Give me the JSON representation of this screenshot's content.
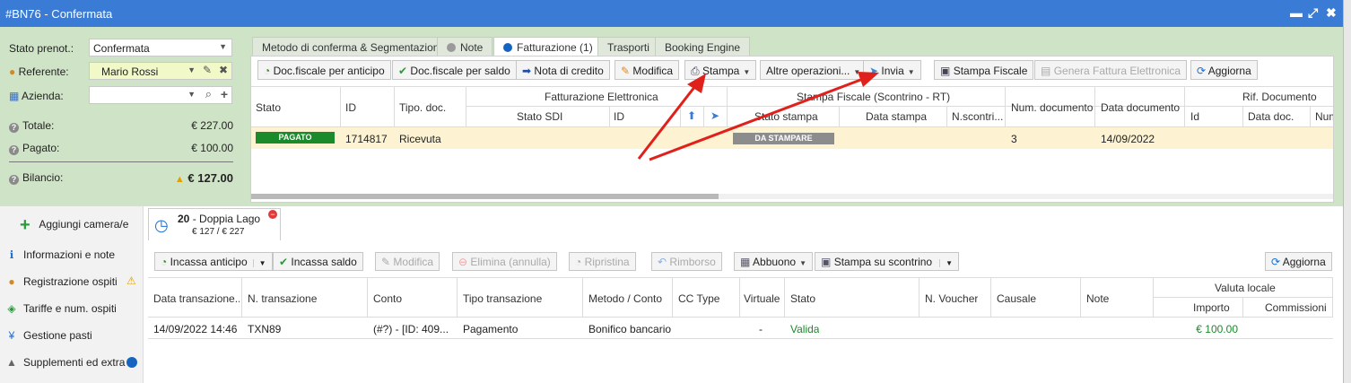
{
  "window": {
    "title": "#BN76 - Confermata",
    "controls": [
      "▬",
      "⤢",
      "✖"
    ]
  },
  "summary": {
    "stato_label": "Stato prenot.:",
    "stato_value": "Confermata",
    "referente_label": "Referente:",
    "referente_value": "Mario Rossi",
    "azienda_label": "Azienda:",
    "azienda_value": "",
    "totale_label": "Totale:",
    "totale_value": "€ 227.00",
    "pagato_label": "Pagato:",
    "pagato_value": "€ 100.00",
    "bilancio_label": "Bilancio:",
    "bilancio_value": "€ 127.00"
  },
  "tabs": [
    {
      "label": "Metodo di conferma & Segmentazione"
    },
    {
      "label": "Note"
    },
    {
      "label": "Fatturazione (1)"
    },
    {
      "label": "Trasporti"
    },
    {
      "label": "Booking Engine"
    }
  ],
  "toolbar": {
    "anticipo": "Doc.fiscale per anticipo",
    "saldo": "Doc.fiscale per saldo",
    "nota": "Nota di credito",
    "modifica": "Modifica",
    "stampa": "Stampa",
    "altre": "Altre operazioni...",
    "invia": "Invia",
    "stampa_fiscale": "Stampa Fiscale",
    "genera": "Genera Fattura Elettronica",
    "aggiorna": "Aggiorna"
  },
  "invoice_table": {
    "headers": {
      "stato": "Stato",
      "id": "ID",
      "tipo": "Tipo. doc.",
      "fe_group": "Fatturazione Elettronica",
      "stato_sdi": "Stato SDI",
      "fe_id": "ID",
      "sf_group": "Stampa Fiscale (Scontrino - RT)",
      "stato_stampa": "Stato stampa",
      "data_stampa": "Data stampa",
      "n_scontrino": "N.scontri...",
      "num_doc": "Num. documento",
      "data_doc": "Data documento",
      "rif_group": "Rif. Documento",
      "rif_id": "Id",
      "rif_data": "Data doc.",
      "rif_num": "Num"
    },
    "row": {
      "stato": "PAGATO",
      "id": "1714817",
      "tipo": "Ricevuta",
      "stato_stampa": "DA STAMPARE",
      "num_doc": "3",
      "data_doc": "14/09/2022"
    }
  },
  "rooms": {
    "add_label": "Aggiungi camera/e",
    "room_number": "20",
    "room_name": "- Doppia Lago",
    "room_amount": "€ 127 / € 227"
  },
  "nav": [
    {
      "label": "Informazioni e note"
    },
    {
      "label": "Registrazione ospiti"
    },
    {
      "label": "Tariffe e num. ospiti"
    },
    {
      "label": "Gestione pasti"
    },
    {
      "label": "Supplementi ed extra"
    }
  ],
  "pay_toolbar": {
    "incassa_anticipo": "Incassa anticipo",
    "incassa_saldo": "Incassa saldo",
    "modifica": "Modifica",
    "elimina": "Elimina (annulla)",
    "ripristina": "Ripristina",
    "rimborso": "Rimborso",
    "abbuono": "Abbuono",
    "stampa_scontrino": "Stampa su scontrino",
    "aggiorna": "Aggiorna"
  },
  "pay_table": {
    "headers": {
      "data": "Data transazione...",
      "ntrans": "N. transazione",
      "conto": "Conto",
      "tipo": "Tipo transazione",
      "metodo": "Metodo / Conto",
      "cc": "CC Type",
      "virtuale": "Virtuale",
      "stato": "Stato",
      "voucher": "N. Voucher",
      "causale": "Causale",
      "note": "Note",
      "valuta": "Valuta locale",
      "importo": "Importo",
      "commissioni": "Commissioni"
    },
    "row": {
      "data": "14/09/2022 14:46",
      "ntrans": "TXN89",
      "conto": "(#?) - [ID: 409...",
      "tipo": "Pagamento",
      "metodo": "Bonifico bancario",
      "virtuale": "-",
      "stato": "Valida",
      "importo": "€ 100.00"
    }
  },
  "colors": {
    "titlebar": "#3a7bd5",
    "panel_bg": "#cfe4c7",
    "badge_green": "#1a8a2a",
    "badge_grey": "#8c8c8c",
    "highlight_row": "#fdf3d3",
    "arrow": "#e0201a"
  }
}
